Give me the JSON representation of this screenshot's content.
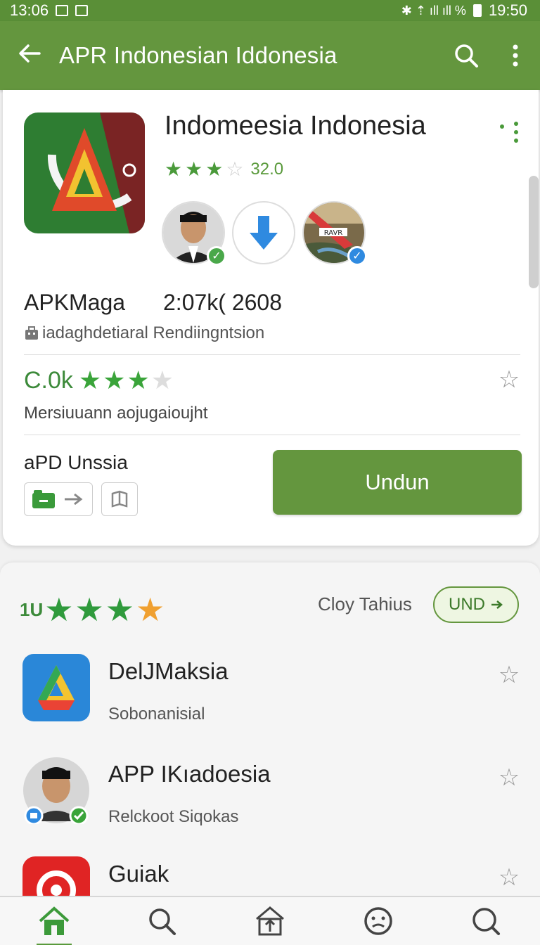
{
  "status_bar": {
    "time_left": "13:06",
    "time_right": "19:50",
    "icons_right": "✱ ⇡ ıll ıll %"
  },
  "app_bar": {
    "title": "APR Indonesian Iddonesia",
    "back_icon": "arrow-left-icon",
    "search_icon": "search-icon",
    "menu_icon": "more-vertical-icon"
  },
  "app_detail": {
    "name": "Indomeesia Indonesia",
    "rating_value": "32.0",
    "rating_stars": 3,
    "developer": "APKMaga",
    "size_info": "2:07k( 2608",
    "developer_sub": "iadaghdetiaral  Rendiingntsion",
    "score": "C.0k",
    "score_stars": 3,
    "score_desc": "Mersiuuann aojugaioujht",
    "apd_label": "aPD Unssia",
    "install_button": "Undun",
    "avatar_badge_image_text": "RAVR"
  },
  "section2": {
    "prefix": "1U",
    "label": "Cloy Tahius",
    "pill": "UND",
    "items": [
      {
        "name": "DelJMaksia",
        "sub": "Sobonanisial"
      },
      {
        "name": "APP IKıadoesia",
        "sub": "Relckoot Siqokas"
      },
      {
        "name": "Guiak",
        "sub": ""
      }
    ]
  },
  "bottom_nav": [
    "home-icon",
    "search-icon",
    "upload-icon",
    "face-icon",
    "search-icon"
  ],
  "colors": {
    "primary": "#64963e",
    "star_green": "#3aa43a",
    "star_gold": "#f0a030"
  }
}
